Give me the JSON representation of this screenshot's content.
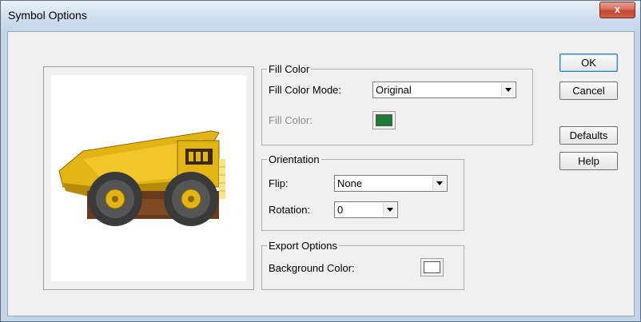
{
  "window": {
    "title": "Symbol Options",
    "close_label": "x"
  },
  "fill_color": {
    "group_label": "Fill Color",
    "mode_label": "Fill Color Mode:",
    "mode_value": "Original",
    "color_label": "Fill Color:",
    "color_hex": "#1e7a36"
  },
  "orientation": {
    "group_label": "Orientation",
    "flip_label": "Flip:",
    "flip_value": "None",
    "rotation_label": "Rotation:",
    "rotation_value": "0"
  },
  "export_options": {
    "group_label": "Export Options",
    "bg_label": "Background Color:",
    "bg_hex": "#ffffff"
  },
  "buttons": {
    "ok": "OK",
    "cancel": "Cancel",
    "defaults": "Defaults",
    "help": "Help"
  },
  "preview": {
    "symbol": "dump-truck-icon"
  }
}
